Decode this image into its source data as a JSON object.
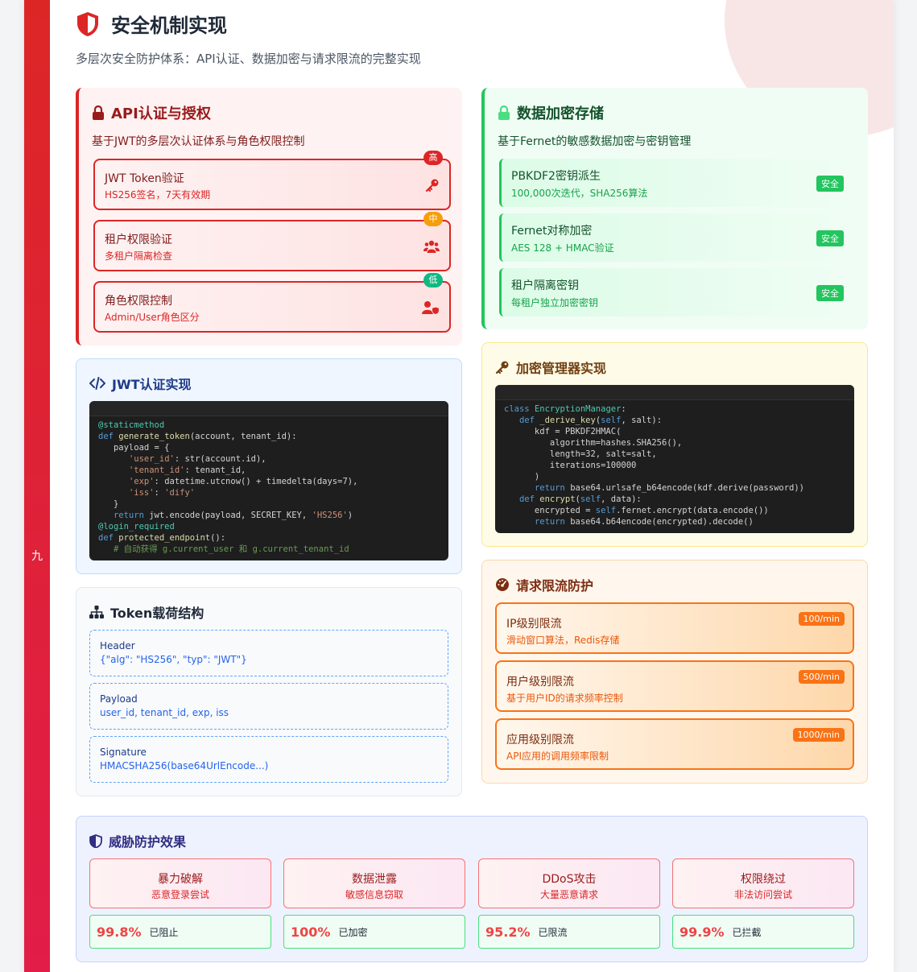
{
  "header": {
    "title": "安全机制实现",
    "subtitle": "多层次安全防护体系：API认证、数据加密与请求限流的完整实现",
    "chapter": "九"
  },
  "auth": {
    "title": "API认证与授权",
    "desc": "基于JWT的多层次认证体系与角色权限控制",
    "items": [
      {
        "title": "JWT Token验证",
        "sub": "HS256签名，7天有效期",
        "level": "高",
        "level_color": "#dc2626",
        "icon": "key-icon"
      },
      {
        "title": "租户权限验证",
        "sub": "多租户隔离检查",
        "level": "中",
        "level_color": "#f59e0b",
        "icon": "users-icon"
      },
      {
        "title": "角色权限控制",
        "sub": "Admin/User角色区分",
        "level": "低",
        "level_color": "#10b981",
        "icon": "user-shield-icon"
      }
    ]
  },
  "encryption": {
    "title": "数据加密存储",
    "desc": "基于Fernet的敏感数据加密与密钥管理",
    "items": [
      {
        "title": "PBKDF2密钥派生",
        "sub": "100,000次迭代，SHA256算法",
        "badge": "安全"
      },
      {
        "title": "Fernet对称加密",
        "sub": "AES 128 + HMAC验证",
        "badge": "安全"
      },
      {
        "title": "租户隔离密钥",
        "sub": "每租户独立加密密钥",
        "badge": "安全"
      }
    ]
  },
  "jwt": {
    "title": "JWT认证实现",
    "code": [
      [
        [
          "dec",
          "@staticmethod"
        ]
      ],
      [
        [
          "kw",
          "def "
        ],
        [
          "fn",
          "generate_token"
        ],
        [
          "",
          "(account, tenant_id):"
        ]
      ],
      [
        [
          "",
          "   payload = {"
        ]
      ],
      [
        [
          "",
          "      "
        ],
        [
          "str",
          "'user_id'"
        ],
        [
          "",
          ": str(account.id),"
        ]
      ],
      [
        [
          "",
          "      "
        ],
        [
          "str",
          "'tenant_id'"
        ],
        [
          "",
          ": tenant_id,"
        ]
      ],
      [
        [
          "",
          "      "
        ],
        [
          "str",
          "'exp'"
        ],
        [
          "",
          ": datetime.utcnow() + timedelta(days=7),"
        ]
      ],
      [
        [
          "",
          "      "
        ],
        [
          "str",
          "'iss'"
        ],
        [
          "",
          ": "
        ],
        [
          "str",
          "'dify'"
        ]
      ],
      [
        [
          "",
          "   }"
        ]
      ],
      [
        [
          "",
          "   "
        ],
        [
          "kw",
          "return "
        ],
        [
          "",
          "jwt.encode(payload, SECRET_KEY, "
        ],
        [
          "str",
          "'HS256'"
        ],
        [
          "",
          ")"
        ]
      ],
      [
        [
          "dec",
          "@login_required"
        ]
      ],
      [
        [
          "kw",
          "def "
        ],
        [
          "fn",
          "protected_endpoint"
        ],
        [
          "",
          "():"
        ]
      ],
      [
        [
          "cm",
          "   # 自动获得 g.current_user 和 g.current_tenant_id"
        ]
      ]
    ]
  },
  "token": {
    "title": "Token载荷结构",
    "items": [
      {
        "title": "Header",
        "sub": "{\"alg\": \"HS256\", \"typ\": \"JWT\"}"
      },
      {
        "title": "Payload",
        "sub": "user_id, tenant_id, exp, iss"
      },
      {
        "title": "Signature",
        "sub": "HMACSHA256(base64UrlEncode...)"
      }
    ]
  },
  "manager": {
    "title": "加密管理器实现",
    "code": [
      [
        [
          "kw",
          "class "
        ],
        [
          "dec",
          "EncryptionManager"
        ],
        [
          "",
          ":"
        ]
      ],
      [
        [
          "",
          "   "
        ],
        [
          "kw",
          "def "
        ],
        [
          "fn",
          "_derive_key"
        ],
        [
          "",
          "("
        ],
        [
          "sf",
          "self"
        ],
        [
          "",
          ", salt):"
        ]
      ],
      [
        [
          "",
          "      kdf = PBKDF2HMAC("
        ]
      ],
      [
        [
          "",
          "         algorithm=hashes.SHA256(),"
        ]
      ],
      [
        [
          "",
          "         length=32, salt=salt,"
        ]
      ],
      [
        [
          "",
          "         iterations=100000"
        ]
      ],
      [
        [
          "",
          "      )"
        ]
      ],
      [
        [
          "",
          "      "
        ],
        [
          "kw",
          "return "
        ],
        [
          "",
          "base64.urlsafe_b64encode(kdf.derive(password))"
        ]
      ],
      [
        [
          "",
          "   "
        ],
        [
          "kw",
          "def "
        ],
        [
          "fn",
          "encrypt"
        ],
        [
          "",
          "("
        ],
        [
          "sf",
          "self"
        ],
        [
          "",
          ", data):"
        ]
      ],
      [
        [
          "",
          "      encrypted = "
        ],
        [
          "sf",
          "self"
        ],
        [
          "",
          ".fernet.encrypt(data.encode())"
        ]
      ],
      [
        [
          "",
          "      "
        ],
        [
          "kw",
          "return "
        ],
        [
          "",
          "base64.b64encode(encrypted).decode()"
        ]
      ]
    ]
  },
  "rate": {
    "title": "请求限流防护",
    "items": [
      {
        "title": "IP级别限流",
        "sub": "滑动窗口算法，Redis存储",
        "badge": "100/min"
      },
      {
        "title": "用户级别限流",
        "sub": "基于用户ID的请求频率控制",
        "badge": "500/min"
      },
      {
        "title": "应用级别限流",
        "sub": "API应用的调用频率限制",
        "badge": "1000/min"
      }
    ]
  },
  "threat": {
    "title": "威胁防护效果",
    "items": [
      {
        "title": "暴力破解",
        "sub": "恶意登录尝试",
        "value": "99.8%",
        "label": "已阻止"
      },
      {
        "title": "数据泄露",
        "sub": "敏感信息窃取",
        "value": "100%",
        "label": "已加密"
      },
      {
        "title": "DDoS攻击",
        "sub": "大量恶意请求",
        "value": "95.2%",
        "label": "已限流"
      },
      {
        "title": "权限绕过",
        "sub": "非法访问尝试",
        "value": "99.9%",
        "label": "已拦截"
      }
    ]
  }
}
